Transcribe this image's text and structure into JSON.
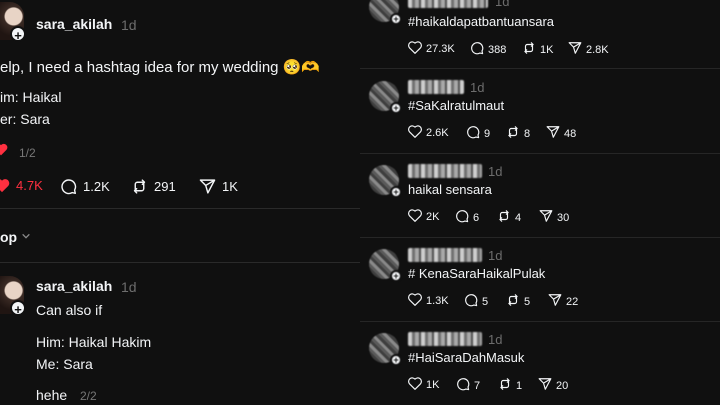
{
  "left": {
    "post1": {
      "username": "sara_akilah",
      "time": "1d",
      "line1": "elp, I need a hashtag idea for my wedding 🥺🫶",
      "line2": "im: Haikal",
      "line3": "er: Sara",
      "counter": "1/2",
      "likes": "4.7K",
      "comments": "1.2K",
      "reposts": "291",
      "shares": "1K"
    },
    "sort_label": "op",
    "post2": {
      "username": "sara_akilah",
      "time": "1d",
      "line1": "Can also if",
      "line2": "Him: Haikal Hakim",
      "line3": "Me: Sara",
      "line4": "hehe",
      "counter": "2/2"
    }
  },
  "right": {
    "replies": [
      {
        "time": "1d",
        "text": "#haikaldapatbantuansara",
        "likes": "27.3K",
        "comments": "388",
        "reposts": "1K",
        "shares": "2.8K"
      },
      {
        "time": "1d",
        "text": "#SaKalratulmaut",
        "likes": "2.6K",
        "comments": "9",
        "reposts": "8",
        "shares": "48"
      },
      {
        "time": "1d",
        "text": "haikal sensara",
        "likes": "2K",
        "comments": "6",
        "reposts": "4",
        "shares": "30"
      },
      {
        "time": "1d",
        "text": "# KenaSaraHaikalPulak",
        "likes": "1.3K",
        "comments": "5",
        "reposts": "5",
        "shares": "22"
      },
      {
        "time": "1d",
        "text": "#HaiSaraDahMasuk",
        "likes": "1K",
        "comments": "7",
        "reposts": "1",
        "shares": "20"
      }
    ]
  },
  "colors": {
    "background": "#101010",
    "text": "#f3f5f7",
    "muted": "#6d6d6d",
    "like_active": "#ff3040",
    "divider": "#2a2a2a"
  },
  "icons": [
    "heart-icon",
    "comment-icon",
    "repost-icon",
    "share-icon",
    "plus-icon",
    "chevron-down-icon"
  ]
}
